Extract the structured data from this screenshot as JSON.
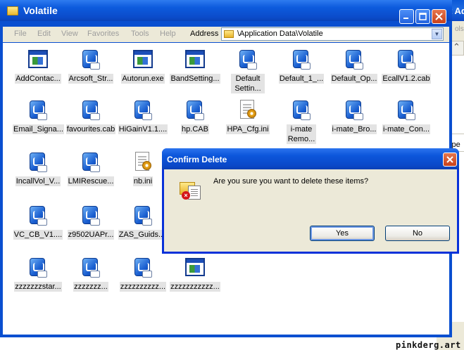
{
  "background_window": {
    "title_fragment": "t Ad",
    "tools_fragment": "ols",
    "type_fragment": "ype"
  },
  "window": {
    "title": "Volatile"
  },
  "menu": [
    "File",
    "Edit",
    "View",
    "Favorites",
    "Tools",
    "Help"
  ],
  "address": {
    "label": "Address",
    "value": "\\Application Data\\Volatile"
  },
  "files": [
    {
      "label": "AddContac...",
      "icon": "exe-icon"
    },
    {
      "label": "Arcsoft_Str...",
      "icon": "setup-package-icon"
    },
    {
      "label": "Autorun.exe",
      "icon": "exe-icon"
    },
    {
      "label": "BandSetting...",
      "icon": "exe-icon"
    },
    {
      "label": "Default Settin...",
      "icon": "setup-package-icon"
    },
    {
      "label": "Default_1_...",
      "icon": "setup-package-icon"
    },
    {
      "label": "Default_Op...",
      "icon": "setup-package-icon"
    },
    {
      "label": "EcallV1.2.cab",
      "icon": "setup-package-icon"
    },
    {
      "label": "Email_Signa...",
      "icon": "setup-package-icon"
    },
    {
      "label": "favourites.cab",
      "icon": "setup-package-icon"
    },
    {
      "label": "HiGainV1.1....",
      "icon": "setup-package-icon"
    },
    {
      "label": "hp.CAB",
      "icon": "setup-package-icon"
    },
    {
      "label": "HPA_Cfg.ini",
      "icon": "ini-file-icon"
    },
    {
      "label": "i-mate Remo...",
      "icon": "setup-package-icon"
    },
    {
      "label": "i-mate_Bro...",
      "icon": "setup-package-icon"
    },
    {
      "label": "i-mate_Con...",
      "icon": "setup-package-icon"
    },
    {
      "label": "IncallVol_V...",
      "icon": "setup-package-icon"
    },
    {
      "label": "LMIRescue...",
      "icon": "setup-package-icon"
    },
    {
      "label": "nb.ini",
      "icon": "ini-file-icon"
    },
    {
      "label": "VC_CB_V1....",
      "icon": "setup-package-icon"
    },
    {
      "label": "z9502UAPr...",
      "icon": "setup-package-icon"
    },
    {
      "label": "ZAS_Guids....",
      "icon": "setup-package-icon"
    },
    {
      "label": "zzzzzzzstar...",
      "icon": "setup-package-icon"
    },
    {
      "label": "zzzzzzz...",
      "icon": "setup-package-icon"
    },
    {
      "label": "zzzzzzzzzz...",
      "icon": "setup-package-icon"
    },
    {
      "label": "zzzzzzzzzzz...",
      "icon": "exe-icon"
    }
  ],
  "dialog": {
    "title": "Confirm Delete",
    "message": "Are you sure you want to delete these items?",
    "yes_label": "Yes",
    "no_label": "No"
  },
  "watermark": "pinkderg.art"
}
